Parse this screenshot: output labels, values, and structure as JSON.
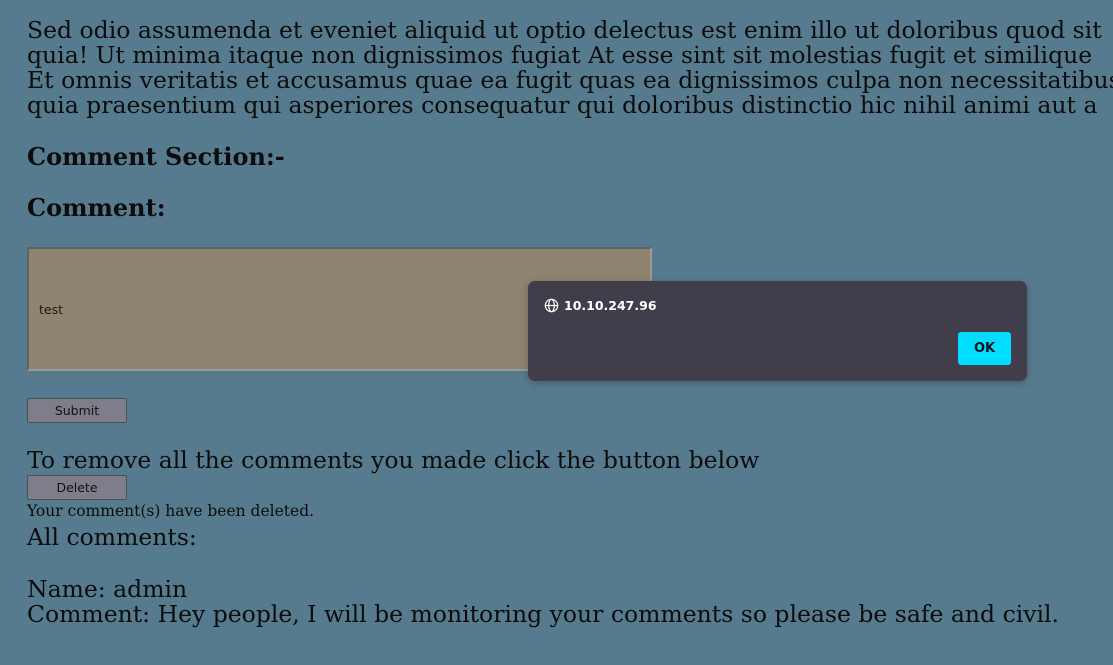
{
  "intro": {
    "lines": [
      "Sed odio assumenda et eveniet aliquid ut optio delectus est enim illo ut doloribus quod sit",
      "quia! Ut minima itaque non dignissimos fugiat At esse sint sit molestias fugit et similique",
      "Et omnis veritatis et accusamus quae ea fugit quas ea dignissimos culpa non necessitatibus",
      "quia praesentium qui asperiores consequatur qui doloribus distinctio hic nihil animi aut a"
    ]
  },
  "headings": {
    "section": "Comment Section:-",
    "comment": "Comment:"
  },
  "form": {
    "comment_value": "test",
    "submit_label": "Submit"
  },
  "remove": {
    "text": "To remove all the comments you made click the button below",
    "delete_label": "Delete",
    "deleted_message": "Your comment(s) have been deleted."
  },
  "comments": {
    "header": "All comments:",
    "items": [
      {
        "name_line": "Name: admin",
        "comment_line": "Comment: Hey people, I will be monitoring your comments so please be safe and civil."
      }
    ]
  },
  "dialog": {
    "origin": "10.10.247.96",
    "origin_icon": "globe-icon",
    "ok_label": "OK",
    "accent_color": "#00ddff"
  }
}
